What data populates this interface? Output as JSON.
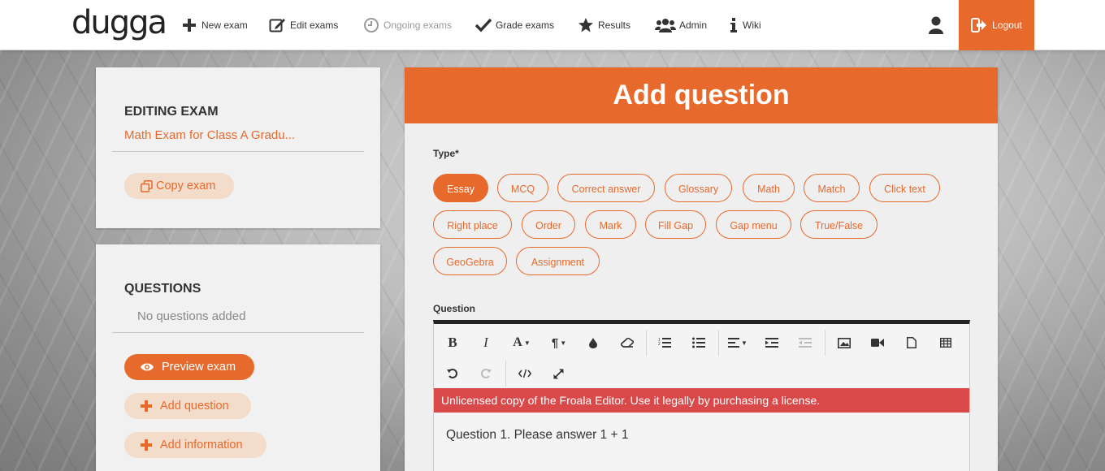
{
  "nav": {
    "logo": "dugga",
    "items": [
      {
        "label": "New exam",
        "icon": "plus-icon"
      },
      {
        "label": "Edit exams",
        "icon": "edit-icon"
      },
      {
        "label": "Ongoing exams",
        "icon": "clock-icon"
      },
      {
        "label": "Grade exams",
        "icon": "check-icon"
      },
      {
        "label": "Results",
        "icon": "star-icon"
      },
      {
        "label": "Admin",
        "icon": "users-icon"
      },
      {
        "label": "Wiki",
        "icon": "info-icon"
      }
    ],
    "logout": "Logout"
  },
  "sidebar": {
    "editing_title": "EDITING EXAM",
    "exam_name": "Math Exam for Class A Gradu...",
    "copy_exam": "Copy exam",
    "questions_title": "QUESTIONS",
    "no_questions": "No questions added",
    "preview": "Preview exam",
    "add_question": "Add question",
    "add_information": "Add information"
  },
  "main": {
    "title": "Add question",
    "type_label": "Type*",
    "types": [
      "Essay",
      "MCQ",
      "Correct answer",
      "Glossary",
      "Math",
      "Match",
      "Click text",
      "Right place",
      "Order",
      "Mark",
      "Fill Gap",
      "Gap menu",
      "True/False",
      "GeoGebra",
      "Assignment"
    ],
    "selected_type": "Essay",
    "question_label": "Question",
    "editor": {
      "warning": "Unlicensed copy of the Froala Editor. Use it legally by purchasing a license.",
      "content": "Question 1. Please answer 1 + 1"
    }
  },
  "colors": {
    "accent": "#e8692c",
    "warning": "#d9494a"
  }
}
